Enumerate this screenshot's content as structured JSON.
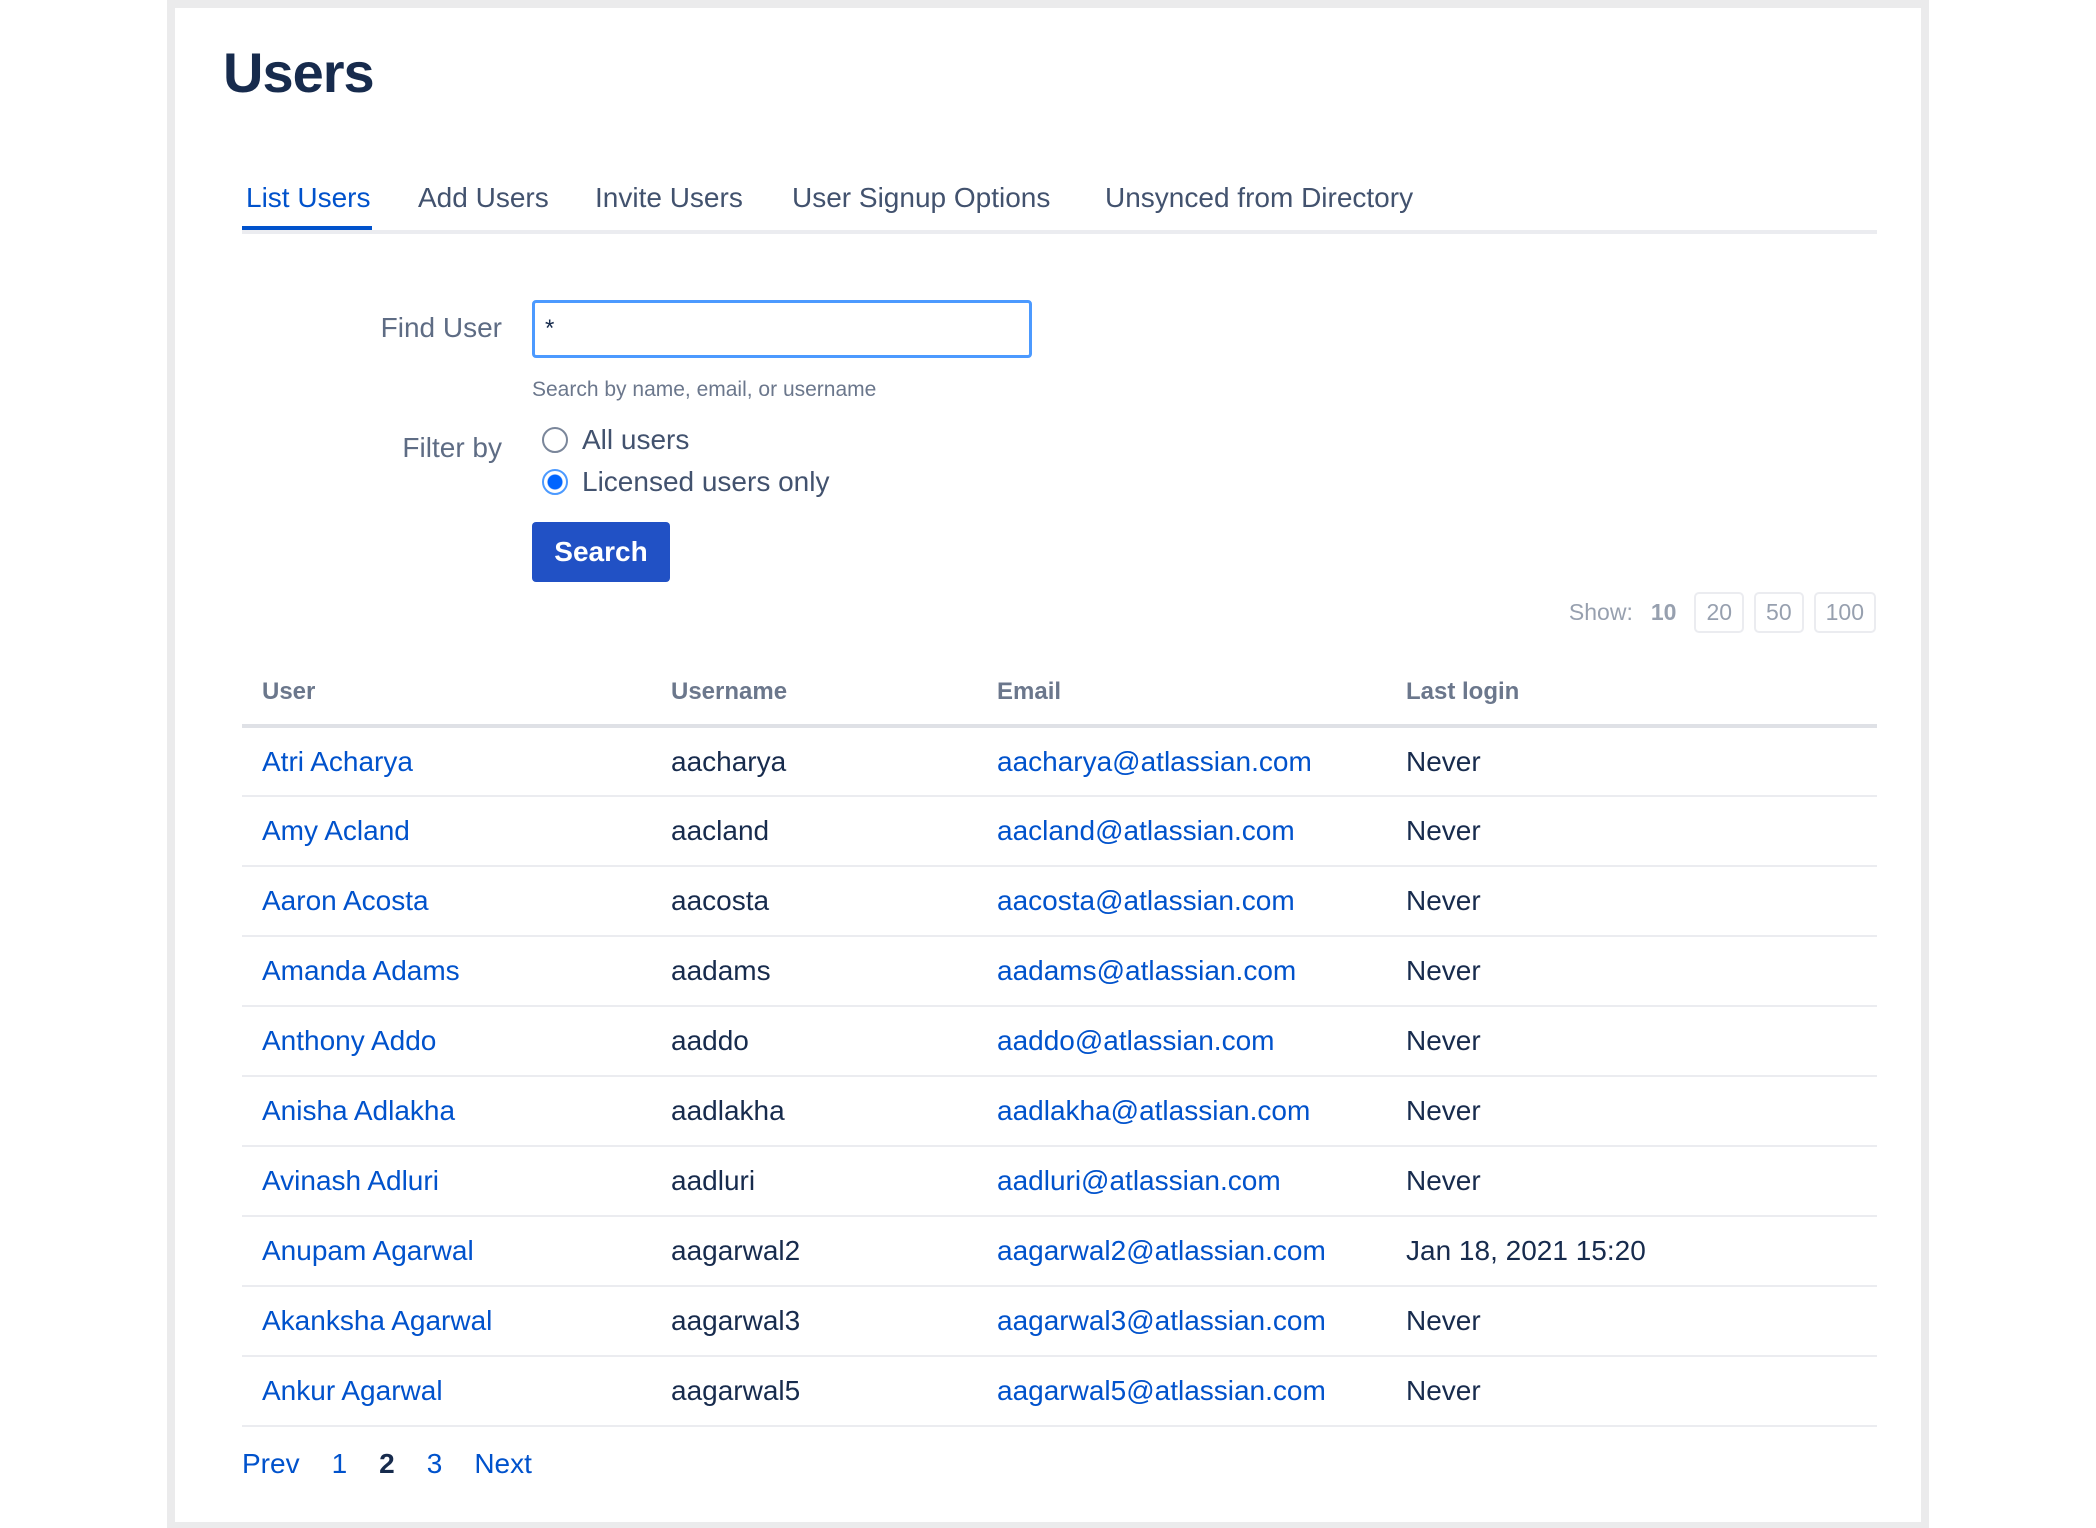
{
  "title": "Users",
  "tabs": [
    {
      "label": "List Users",
      "active": true
    },
    {
      "label": "Add Users"
    },
    {
      "label": "Invite Users"
    },
    {
      "label": "User Signup Options"
    },
    {
      "label": "Unsynced from Directory"
    }
  ],
  "form": {
    "find_label": "Find User",
    "find_value": "*",
    "help": "Search by name, email, or username",
    "filter_label": "Filter by",
    "options": [
      "All users",
      "Licensed users only"
    ],
    "selected": "Licensed users only",
    "search_button": "Search"
  },
  "show": {
    "label": "Show:",
    "current": "10",
    "options": [
      "20",
      "50",
      "100"
    ]
  },
  "table": {
    "headers": [
      "User",
      "Username",
      "Email",
      "Last login"
    ],
    "rows": [
      [
        "Atri Acharya",
        "aacharya",
        "aacharya@atlassian.com",
        "Never"
      ],
      [
        "Amy Acland",
        "aacland",
        "aacland@atlassian.com",
        "Never"
      ],
      [
        "Aaron Acosta",
        "aacosta",
        "aacosta@atlassian.com",
        "Never"
      ],
      [
        "Amanda Adams",
        "aadams",
        "aadams@atlassian.com",
        "Never"
      ],
      [
        "Anthony Addo",
        "aaddo",
        "aaddo@atlassian.com",
        "Never"
      ],
      [
        "Anisha Adlakha",
        "aadlakha",
        "aadlakha@atlassian.com",
        "Never"
      ],
      [
        "Avinash Adluri",
        "aadluri",
        "aadluri@atlassian.com",
        "Never"
      ],
      [
        "Anupam Agarwal",
        "aagarwal2",
        "aagarwal2@atlassian.com",
        "Jan 18, 2021 15:20"
      ],
      [
        "Akanksha Agarwal",
        "aagarwal3",
        "aagarwal3@atlassian.com",
        "Never"
      ],
      [
        "Ankur Agarwal",
        "aagarwal5",
        "aagarwal5@atlassian.com",
        "Never"
      ]
    ]
  },
  "pagination": {
    "prev": "Prev",
    "pages": [
      "1",
      "2",
      "3"
    ],
    "current": "2",
    "next": "Next"
  }
}
